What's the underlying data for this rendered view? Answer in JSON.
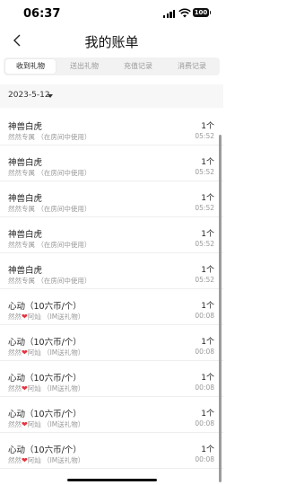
{
  "status": {
    "time": "06:37",
    "battery": "100"
  },
  "header": {
    "title": "我的账单"
  },
  "tabs": [
    {
      "label": "收到礼物",
      "active": true
    },
    {
      "label": "送出礼物",
      "active": false
    },
    {
      "label": "充值记录",
      "active": false
    },
    {
      "label": "消费记录",
      "active": false
    }
  ],
  "filter": {
    "date": "2023-5-12"
  },
  "records": [
    {
      "name": "神兽白虎",
      "from": "然然专属",
      "note": "（在房间中使用）",
      "qty": "1个",
      "time": "05:52"
    },
    {
      "name": "神兽白虎",
      "from": "然然专属",
      "note": "（在房间中使用）",
      "qty": "1个",
      "time": "05:52"
    },
    {
      "name": "神兽白虎",
      "from": "然然专属",
      "note": "（在房间中使用）",
      "qty": "1个",
      "time": "05:52"
    },
    {
      "name": "神兽白虎",
      "from": "然然专属",
      "note": "（在房间中使用）",
      "qty": "1个",
      "time": "05:52"
    },
    {
      "name": "神兽白虎",
      "from": "然然专属",
      "note": "（在房间中使用）",
      "qty": "1个",
      "time": "05:52"
    },
    {
      "name": "心动（10六币/个）",
      "from": "然然",
      "from2": "阿灿",
      "note": "（IM送礼物）",
      "qty": "1个",
      "time": "00:08"
    },
    {
      "name": "心动（10六币/个）",
      "from": "然然",
      "from2": "阿灿",
      "note": "（IM送礼物）",
      "qty": "1个",
      "time": "00:08"
    },
    {
      "name": "心动（10六币/个）",
      "from": "然然",
      "from2": "阿灿",
      "note": "（IM送礼物）",
      "qty": "1个",
      "time": "00:08"
    },
    {
      "name": "心动（10六币/个）",
      "from": "然然",
      "from2": "阿灿",
      "note": "（IM送礼物）",
      "qty": "1个",
      "time": "00:08"
    },
    {
      "name": "心动（10六币/个）",
      "from": "然然",
      "from2": "阿灿",
      "note": "（IM送礼物）",
      "qty": "1个",
      "time": "00:08"
    }
  ]
}
